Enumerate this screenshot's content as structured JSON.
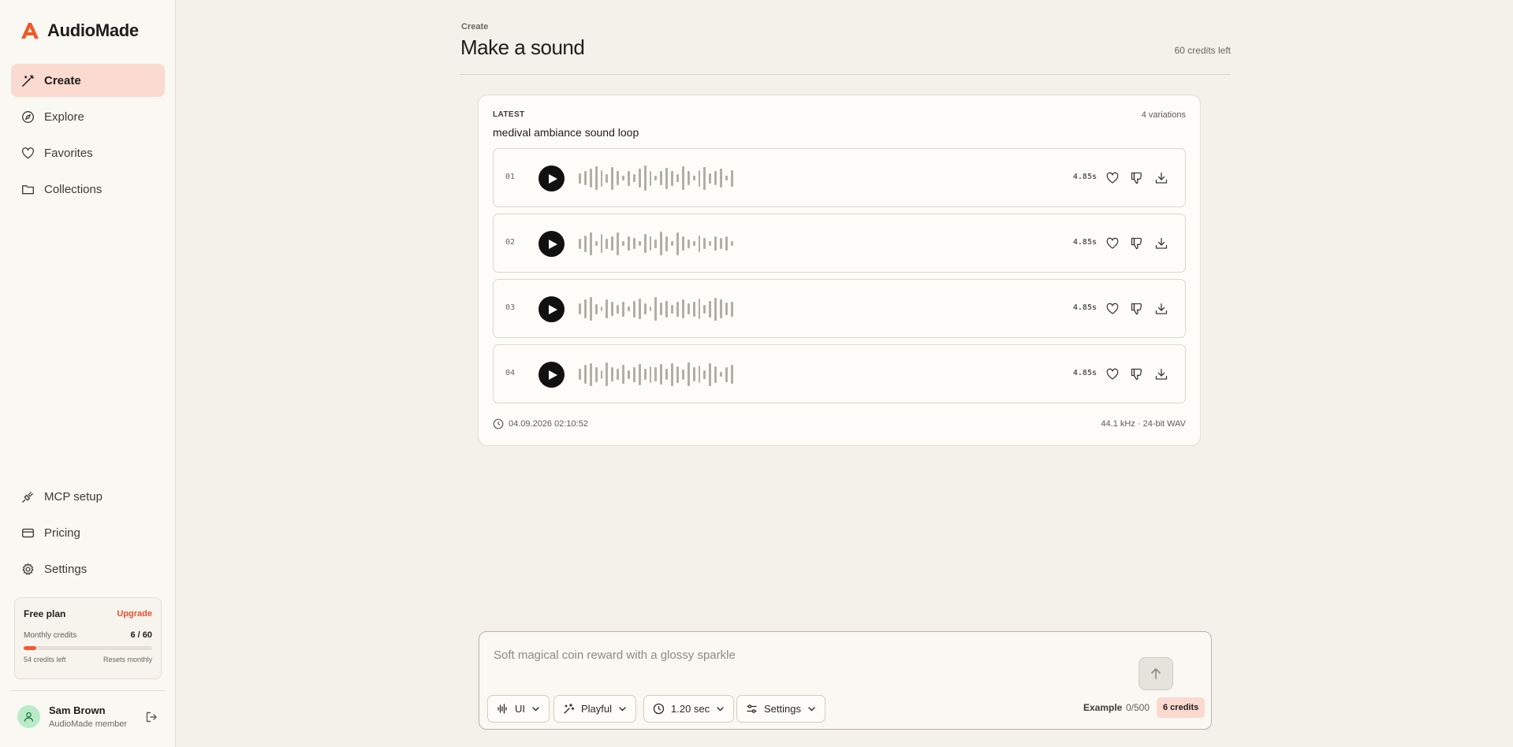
{
  "brand": {
    "name": "AudioMade",
    "accent": "#f05a28"
  },
  "sidebar": {
    "nav": [
      {
        "label": "Create",
        "icon": "magic-wand-icon",
        "active": true
      },
      {
        "label": "Explore",
        "icon": "compass-icon",
        "active": false
      },
      {
        "label": "Favorites",
        "icon": "heart-icon",
        "active": false
      },
      {
        "label": "Collections",
        "icon": "folder-icon",
        "active": false
      }
    ],
    "bottom_nav": [
      {
        "label": "MCP setup",
        "icon": "plug-icon"
      },
      {
        "label": "Pricing",
        "icon": "credit-card-icon"
      },
      {
        "label": "Settings",
        "icon": "gear-icon"
      }
    ],
    "plan": {
      "title": "Free plan",
      "upgrade_label": "Upgrade",
      "monthly_label": "Monthly credits",
      "count": "6 / 60",
      "used_fraction": 0.1,
      "left_label": "54 credits left",
      "reset_label": "Resets monthly"
    },
    "user": {
      "name": "Sam Brown",
      "role": "AudioMade member"
    }
  },
  "header": {
    "breadcrumb": "Create",
    "title": "Make a sound",
    "credits_left": "60 credits left"
  },
  "result": {
    "section_label": "LATEST",
    "variations": "4 variations",
    "prompt": "medival ambiance sound loop",
    "tracks": [
      {
        "num": "01",
        "duration": "4.85s",
        "wave": [
          0.4,
          0.55,
          0.75,
          0.95,
          0.65,
          0.35,
          0.9,
          0.55,
          0.2,
          0.6,
          0.3,
          0.75,
          1.0,
          0.6,
          0.2,
          0.55,
          0.85,
          0.6,
          0.3,
          0.95,
          0.55,
          0.2,
          0.65,
          0.9,
          0.4,
          0.55,
          0.75,
          0.2,
          0.65
        ]
      },
      {
        "num": "02",
        "duration": "4.85s",
        "wave": [
          0.4,
          0.65,
          0.9,
          0.2,
          0.75,
          0.4,
          0.55,
          0.9,
          0.2,
          0.55,
          0.45,
          0.2,
          0.75,
          0.55,
          0.35,
          0.95,
          0.6,
          0.2,
          0.9,
          0.55,
          0.35,
          0.2,
          0.65,
          0.45,
          0.2,
          0.55,
          0.45,
          0.55,
          0.2
        ]
      },
      {
        "num": "03",
        "duration": "4.85s",
        "wave": [
          0.45,
          0.75,
          0.95,
          0.4,
          0.2,
          0.75,
          0.55,
          0.35,
          0.6,
          0.2,
          0.65,
          0.8,
          0.45,
          0.2,
          0.95,
          0.5,
          0.65,
          0.35,
          0.6,
          0.75,
          0.45,
          0.6,
          0.8,
          0.35,
          0.65,
          0.9,
          0.75,
          0.5,
          0.6
        ]
      },
      {
        "num": "04",
        "duration": "4.85s",
        "wave": [
          0.45,
          0.75,
          0.9,
          0.6,
          0.35,
          0.95,
          0.55,
          0.45,
          0.75,
          0.35,
          0.6,
          0.85,
          0.45,
          0.65,
          0.55,
          0.8,
          0.45,
          0.9,
          0.65,
          0.4,
          0.95,
          0.55,
          0.7,
          0.35,
          0.9,
          0.65,
          0.2,
          0.6,
          0.75
        ]
      }
    ],
    "timestamp": "04.09.2026 02:10:52",
    "format": "44.1 kHz · 24-bit WAV"
  },
  "composer": {
    "placeholder": "Soft magical coin reward with a glossy sparkle",
    "chips": [
      {
        "label": "UI",
        "icon": "waveform-icon"
      },
      {
        "label": "Playful",
        "icon": "sparkles-icon"
      },
      {
        "label": "1.20 sec",
        "icon": "clock-icon"
      },
      {
        "label": "Settings",
        "icon": "sliders-icon"
      }
    ],
    "example_label": "Example",
    "char_count": "0/500",
    "cost": "6 credits"
  }
}
